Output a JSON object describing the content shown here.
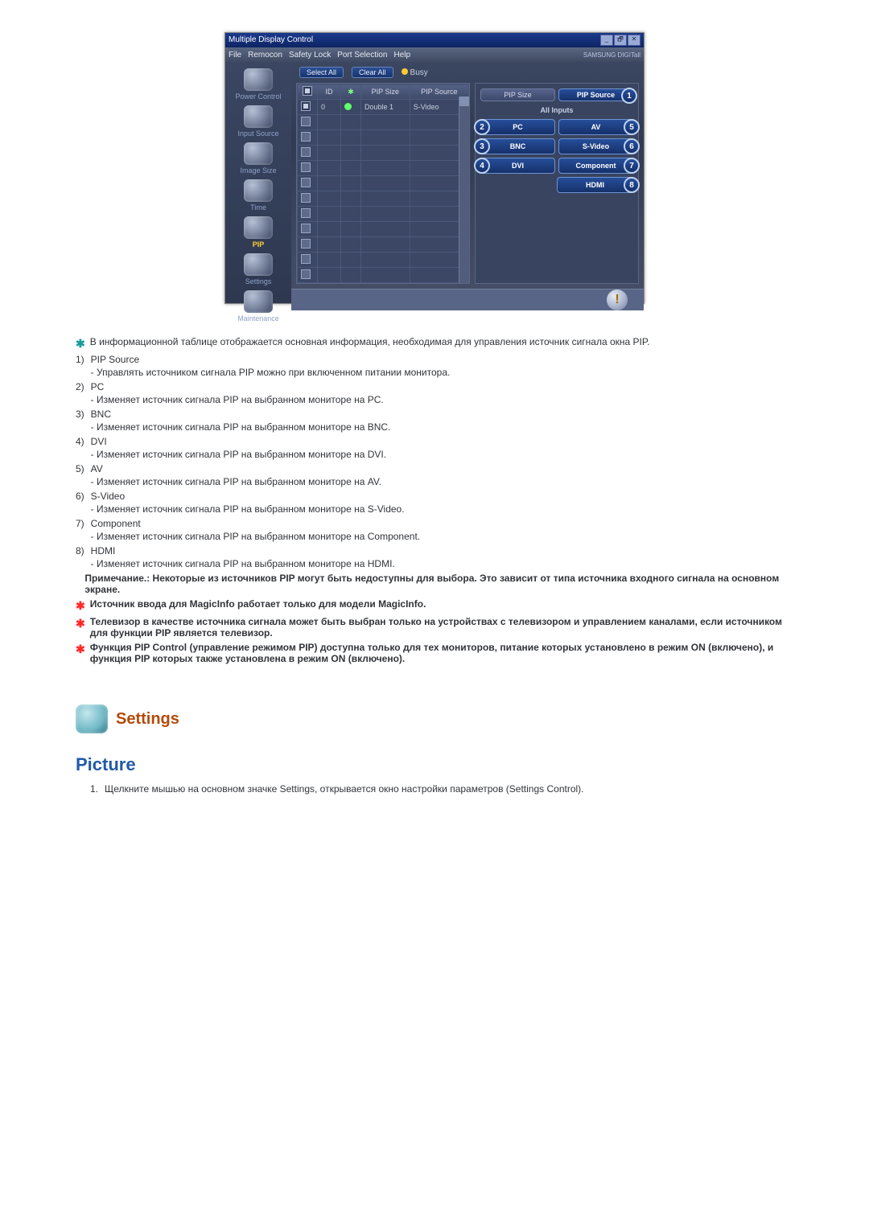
{
  "window": {
    "title": "Multiple Display Control",
    "min": "_",
    "restore": "🗗",
    "close": "✕"
  },
  "menubar": {
    "items": [
      "File",
      "Remocon",
      "Safety Lock",
      "Port Selection",
      "Help"
    ],
    "brand": "SAMSUNG DIGITall"
  },
  "sidebar": {
    "items": [
      {
        "label": "Power Control"
      },
      {
        "label": "Input Source"
      },
      {
        "label": "Image Size"
      },
      {
        "label": "Time"
      },
      {
        "label": "PIP",
        "active": true
      },
      {
        "label": "Settings"
      },
      {
        "label": "Maintenance"
      }
    ]
  },
  "toolbar": {
    "select_all": "Select All",
    "clear_all": "Clear All",
    "busy": "Busy"
  },
  "table": {
    "headers": {
      "check": "",
      "id": "ID",
      "lamp": "",
      "pip_size": "PIP Size",
      "pip_source": "PIP Source"
    },
    "row0": {
      "id": "0",
      "pip_size": "Double 1",
      "pip_source": "S-Video"
    }
  },
  "panel": {
    "tab_pip_size": "PIP Size",
    "tab_pip_source": "PIP Source",
    "callout_1": "1",
    "all_inputs": "All Inputs",
    "buttons": {
      "pc": {
        "label": "PC",
        "num": "2"
      },
      "av": {
        "label": "AV",
        "num": "5"
      },
      "bnc": {
        "label": "BNC",
        "num": "3"
      },
      "svideo": {
        "label": "S-Video",
        "num": "6"
      },
      "dvi": {
        "label": "DVI",
        "num": "4"
      },
      "component": {
        "label": "Component",
        "num": "7"
      },
      "hdmi": {
        "label": "HDMI",
        "num": "8"
      }
    }
  },
  "footer_hint": "!",
  "article": {
    "intro": "В информационной таблице отображается основная информация, необходимая для управления источник сигнала окна PIP.",
    "items": [
      {
        "num": "1)",
        "title": "PIP Source",
        "desc": "- Управлять источником сигнала PIP можно при включенном питании монитора."
      },
      {
        "num": "2)",
        "title": "PC",
        "desc": "- Изменяет источник сигнала PIP на выбранном мониторе на PC."
      },
      {
        "num": "3)",
        "title": "BNC",
        "desc": "- Изменяет источник сигнала PIP на выбранном мониторе на BNC."
      },
      {
        "num": "4)",
        "title": "DVI",
        "desc": "- Изменяет источник сигнала PIP на выбранном мониторе на DVI."
      },
      {
        "num": "5)",
        "title": "AV",
        "desc": "- Изменяет источник сигнала PIP на выбранном мониторе на AV."
      },
      {
        "num": "6)",
        "title": "S-Video",
        "desc": "- Изменяет источник сигнала PIP на выбранном мониторе на S-Video."
      },
      {
        "num": "7)",
        "title": "Component",
        "desc": "- Изменяет источник сигнала PIP на выбранном мониторе на Component."
      },
      {
        "num": "8)",
        "title": "HDMI",
        "desc": "- Изменяет источник сигнала PIP на выбранном мониторе на HDMI."
      }
    ],
    "primary_note": "Примечание.: Некоторые из источников PIP могут быть недоступны для выбора. Это зависит от типа источника входного сигнала на основном экране.",
    "notes": [
      "Источник ввода для MagicInfo работает только для модели MagicInfo.",
      "Телевизор в качестве источника сигнала может быть выбран только на устройствах с телевизором и управлением каналами, если источником для функции PIP является телевизор.",
      "Функция PIP Control (управление режимом PIP) доступна только для тех мониторов, питание которых установлено в режим ON (включено), и функция PIP которых также установлена в режим ON (включено)."
    ],
    "settings_title": "Settings",
    "picture_title": "Picture",
    "picture_item_num": "1.",
    "picture_item_text": "Щелкните мышью на основном значке Settings, открывается окно настройки параметров (Settings Control)."
  }
}
